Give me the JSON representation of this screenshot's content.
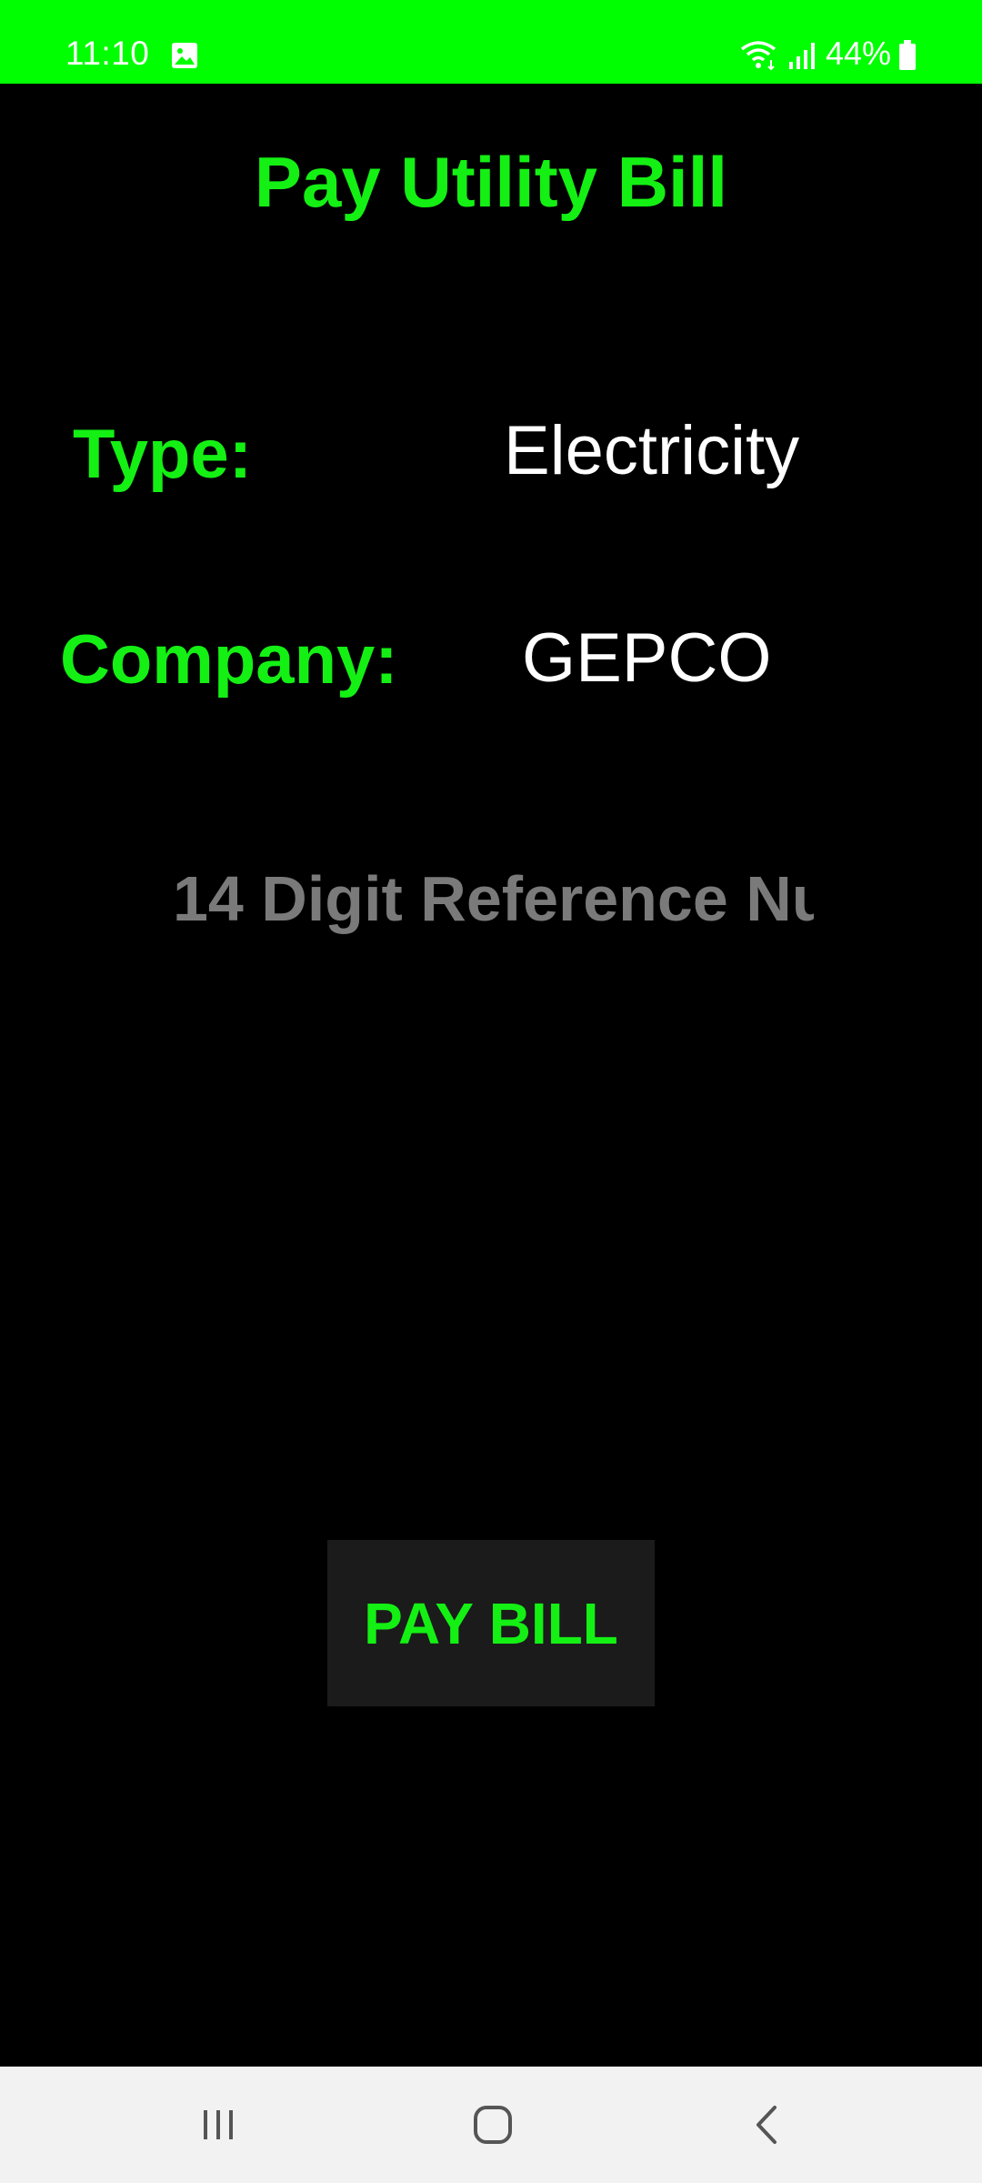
{
  "status_bar": {
    "time": "11:10",
    "battery": "44%",
    "icons": [
      "image-icon",
      "wifi-icon",
      "signal-icon",
      "battery-icon"
    ],
    "background_color": "#00ff00"
  },
  "title": "Pay Utility Bill",
  "fields": {
    "type_label": "Type:",
    "type_value": "Electricity",
    "company_label": "Company:",
    "company_value": "GEPCO"
  },
  "reference_input": {
    "value": "",
    "placeholder": "14 Digit Reference Nu"
  },
  "pay_button": {
    "label": "PAY BILL"
  },
  "nav_bar": {
    "buttons": [
      "recents-icon",
      "home-icon",
      "back-icon"
    ]
  },
  "colors": {
    "accent": "#14f014",
    "background": "#000000",
    "value_text": "#ffffff",
    "placeholder": "#7a7a7a",
    "button_bg": "#1b1b1b"
  }
}
